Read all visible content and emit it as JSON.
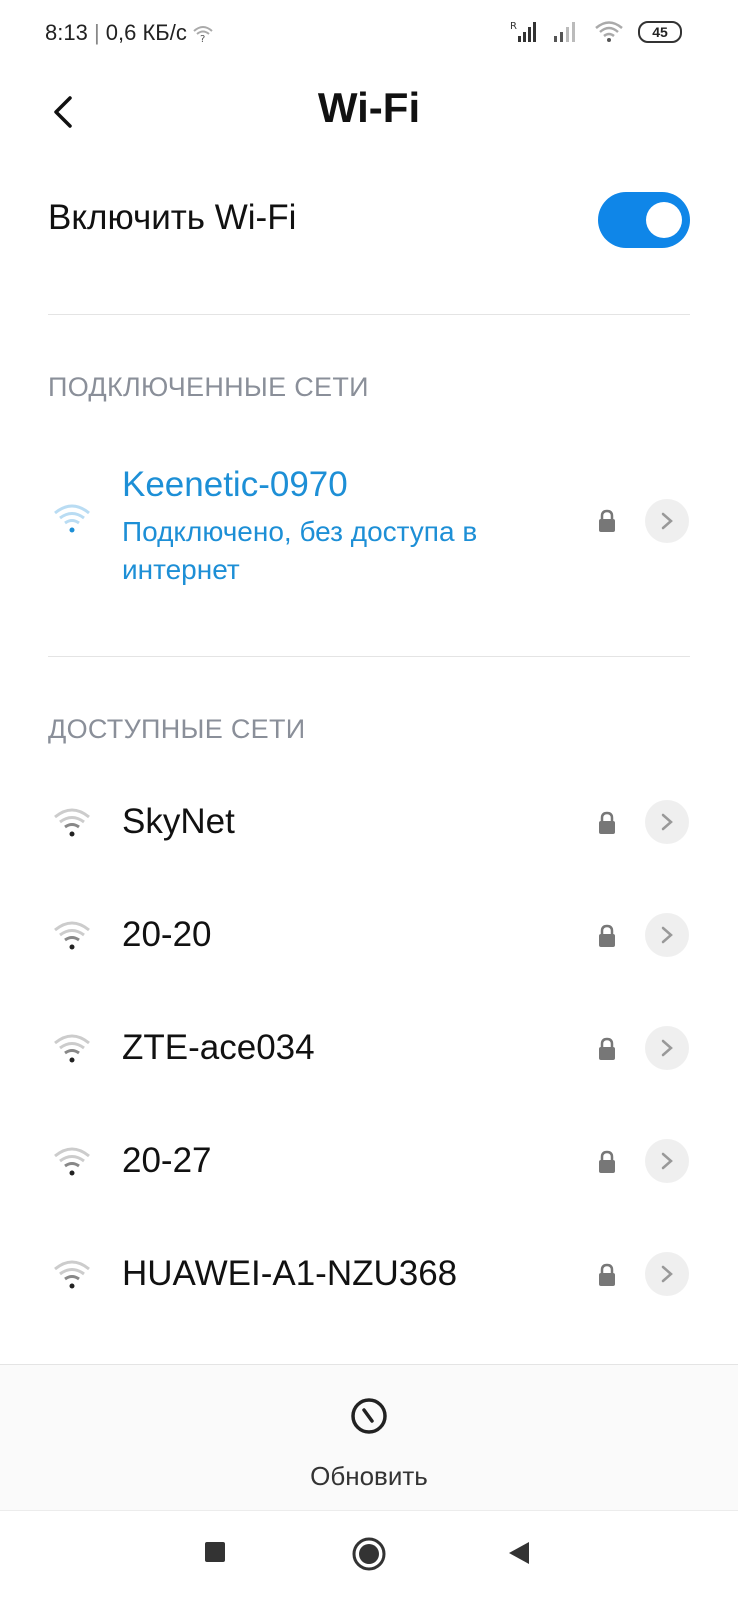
{
  "status_bar": {
    "time": "8:13",
    "separator": "|",
    "speed": "0,6 КБ/с",
    "battery": "45",
    "icons": [
      "wifi-question-icon",
      "signal-roaming-icon",
      "signal-icon",
      "wifi-icon",
      "battery-icon"
    ]
  },
  "header": {
    "title": "Wi-Fi",
    "back_icon": "back-arrow-icon"
  },
  "toggle": {
    "label": "Включить Wi-Fi",
    "enabled": true,
    "accent": "#0f86e8"
  },
  "connected_section": {
    "title": "ПОДКЛЮЧЕННЫЕ СЕТИ",
    "network": {
      "name": "Keenetic-0970",
      "status": "Подключено, без доступа в интернет",
      "color": "#1d8fd6"
    }
  },
  "available_section": {
    "title": "ДОСТУПНЫЕ СЕТИ",
    "networks": [
      {
        "name": "SkyNet"
      },
      {
        "name": "20-20"
      },
      {
        "name": "ZTE-ace034"
      },
      {
        "name": "20-27"
      },
      {
        "name": "HUAWEI-A1-NZU368"
      }
    ]
  },
  "refresh": {
    "label": "Обновить",
    "icon": "refresh-icon"
  },
  "navbar": {
    "icons": [
      "recents-square-icon",
      "home-circle-icon",
      "back-triangle-icon"
    ]
  }
}
